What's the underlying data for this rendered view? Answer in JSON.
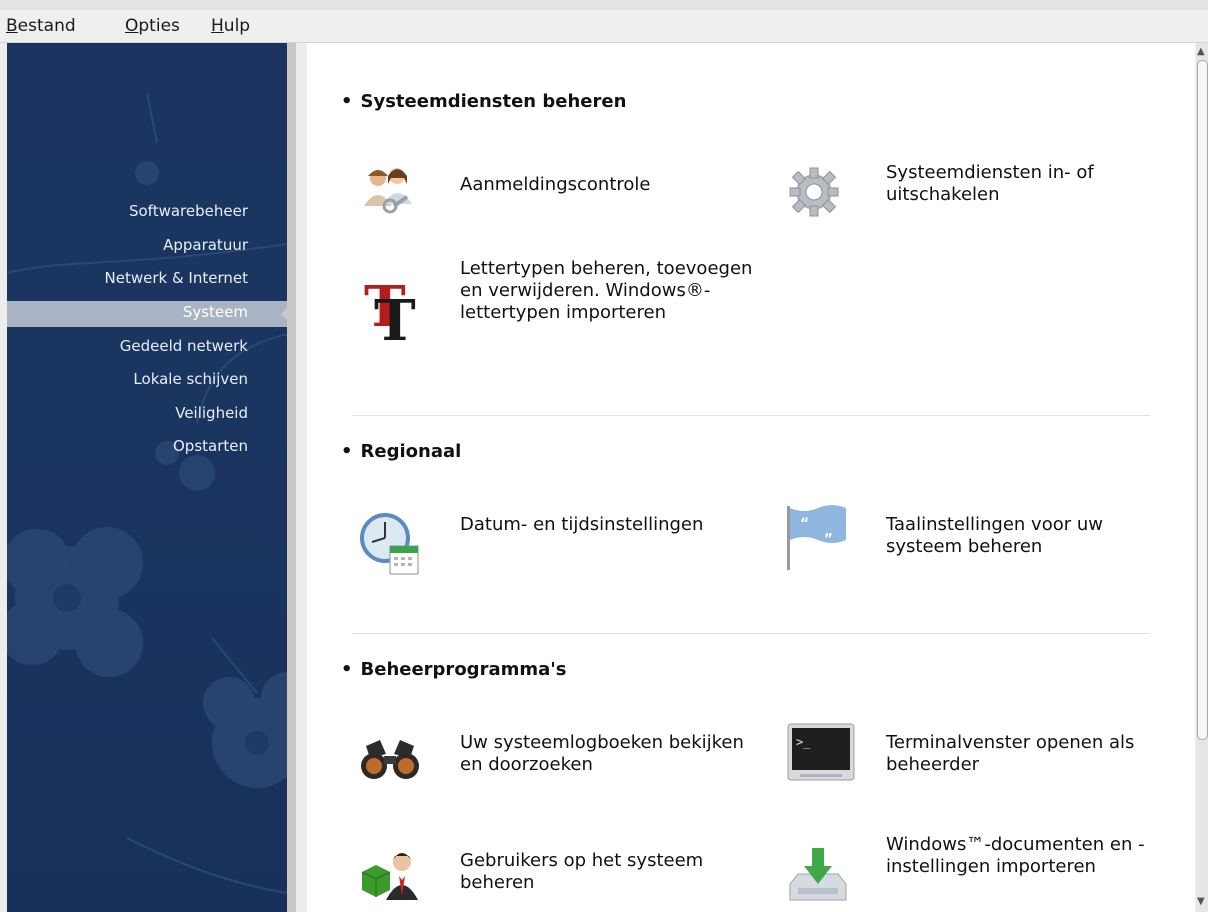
{
  "menubar": {
    "file": {
      "mnemonic": "B",
      "rest": "estand"
    },
    "options": {
      "mnemonic": "O",
      "rest": "pties"
    },
    "help": {
      "mnemonic": "H",
      "rest": "ulp"
    }
  },
  "sidebar": {
    "items": [
      {
        "label": "Softwarebeheer"
      },
      {
        "label": "Apparatuur"
      },
      {
        "label": "Netwerk & Internet"
      },
      {
        "label": "Systeem"
      },
      {
        "label": "Gedeeld netwerk"
      },
      {
        "label": "Lokale schijven"
      },
      {
        "label": "Veiligheid"
      },
      {
        "label": "Opstarten"
      }
    ],
    "active_index": 3
  },
  "sections": [
    {
      "title": "Systeemdiensten beheren",
      "tools": [
        {
          "label": "Aanmeldingscontrole",
          "icon": "users-key-icon"
        },
        {
          "label": "Systeemdiensten in- of uitschakelen",
          "icon": "gear-icon"
        },
        {
          "label": "Lettertypen beheren, toevoegen en verwijderen. Windows®-lettertypen importeren",
          "icon": "font-icon"
        }
      ]
    },
    {
      "title": "Regionaal",
      "tools": [
        {
          "label": "Datum- en tijdsinstellingen",
          "icon": "clock-calendar-icon"
        },
        {
          "label": "Taalinstellingen voor uw systeem beheren",
          "icon": "language-flag-icon"
        }
      ]
    },
    {
      "title": "Beheerprogramma's",
      "tools": [
        {
          "label": "Uw systeemlogboeken bekijken en doorzoeken",
          "icon": "binoculars-icon"
        },
        {
          "label": "Terminalvenster openen als beheerder",
          "icon": "terminal-icon"
        },
        {
          "label": "Gebruikers op het systeem beheren",
          "icon": "user-admin-icon"
        },
        {
          "label": "Windows™-documenten en -instellingen importeren",
          "icon": "import-icon"
        }
      ]
    }
  ],
  "colors": {
    "sidebar_bg": "#1b3560",
    "sidebar_active": "#a8b4c4",
    "content_bg": "#ffffff"
  }
}
